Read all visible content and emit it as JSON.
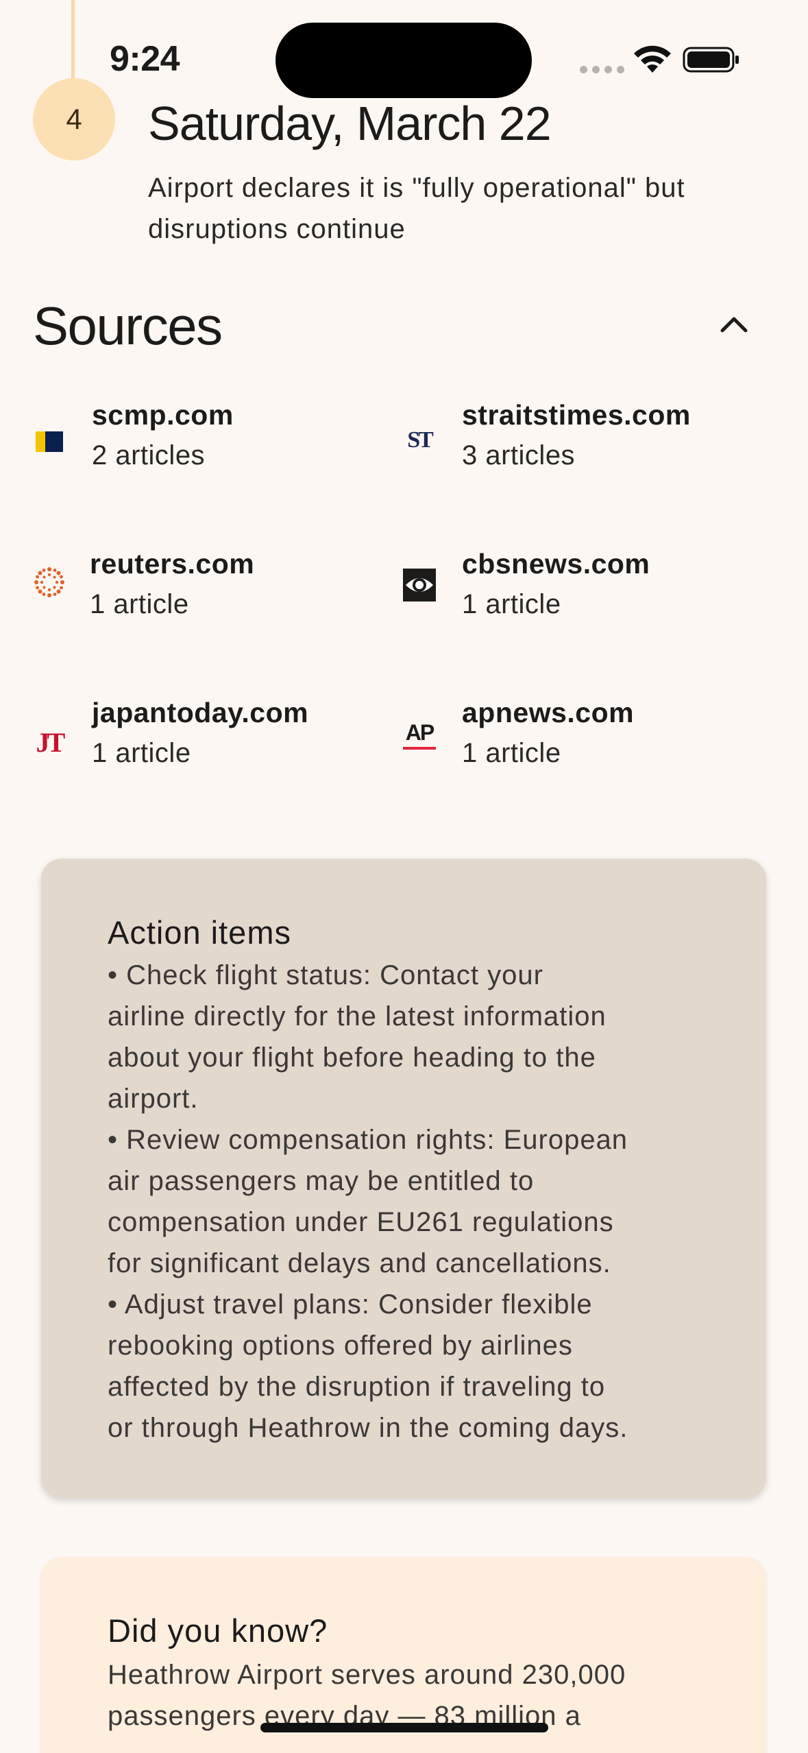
{
  "status_bar": {
    "time": "9:24"
  },
  "timeline": {
    "step_number": "4",
    "date": "Saturday, March 22",
    "description": "Airport declares it is \"fully operational\" but disruptions continue"
  },
  "sources": {
    "title": "Sources",
    "items": [
      {
        "domain": "scmp.com",
        "count": "2 articles",
        "icon": "scmp-logo"
      },
      {
        "domain": "straitstimes.com",
        "count": "3 articles",
        "icon": "straitstimes-logo",
        "logo_text": "ST"
      },
      {
        "domain": "reuters.com",
        "count": "1 article",
        "icon": "reuters-logo"
      },
      {
        "domain": "cbsnews.com",
        "count": "1 article",
        "icon": "cbs-eye-logo"
      },
      {
        "domain": "japantoday.com",
        "count": "1 article",
        "icon": "japantoday-logo",
        "logo_text": "JT"
      },
      {
        "domain": "apnews.com",
        "count": "1 article",
        "icon": "ap-logo",
        "logo_text": "AP"
      }
    ]
  },
  "action_items": {
    "title": "Action items",
    "lines": [
      "• Check flight status: Contact your",
      "airline directly for the latest information",
      "about your flight before heading to the",
      "airport.",
      "• Review compensation rights: European",
      "air passengers may be entitled to",
      "compensation under EU261 regulations",
      "for significant delays and cancellations.",
      "• Adjust travel plans: Consider flexible",
      "rebooking options offered by airlines",
      "affected by the disruption if traveling to",
      "or through Heathrow in the coming days."
    ]
  },
  "did_you_know": {
    "title": "Did you know?",
    "lines": [
      "Heathrow Airport serves around 230,000",
      "passengers every day — 83 million a"
    ]
  },
  "colors": {
    "background": "#fdf7f3",
    "step_circle": "#fbe0b3",
    "action_card": "#e3d8cc",
    "know_card": "#fdeedd"
  }
}
